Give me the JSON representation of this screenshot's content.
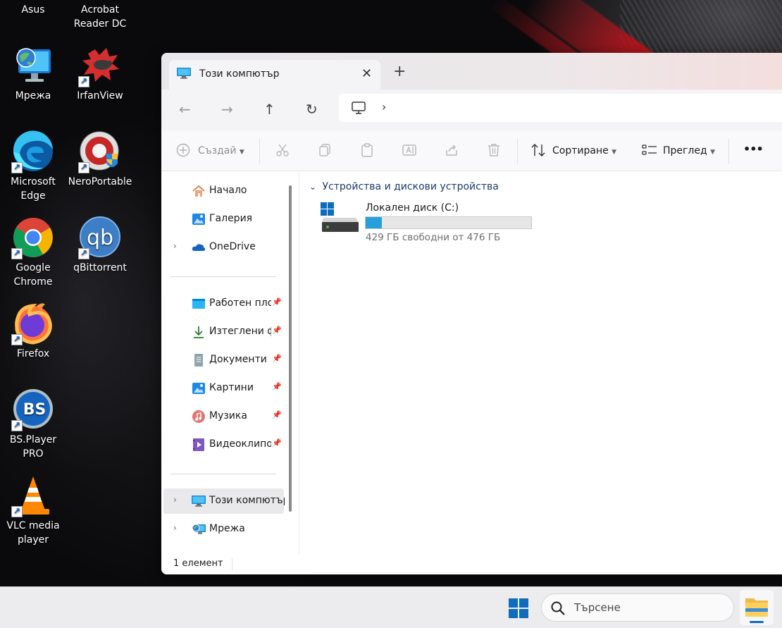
{
  "desktop": {
    "icons": [
      {
        "label": "Asus"
      },
      {
        "label": "Acrobat Reader DC"
      },
      {
        "label": "Мрежа"
      },
      {
        "label": "IrfanView"
      },
      {
        "label": "Microsoft Edge"
      },
      {
        "label": "NeroPortable"
      },
      {
        "label": "Google Chrome"
      },
      {
        "label": "qBittorrent"
      },
      {
        "label": "Firefox"
      },
      {
        "label": "BS.Player PRO"
      },
      {
        "label": "VLC media player"
      }
    ],
    "qb_glyph": "qb",
    "bs_glyph": "BS"
  },
  "window": {
    "tab_title": "Този компютър",
    "tab_close": "✕",
    "new_tab": "+",
    "nav": {
      "back": "←",
      "forward": "→",
      "up": "↑",
      "refresh": "↻",
      "chevron": "›"
    },
    "toolbar": {
      "create_label": "Създай",
      "sort_label": "Сортиране",
      "view_label": "Преглед",
      "more": "•••"
    },
    "sidebar": {
      "items": [
        {
          "label": "Начало"
        },
        {
          "label": "Галерия"
        },
        {
          "label": "OneDrive"
        },
        {
          "label": "Работен плот"
        },
        {
          "label": "Изтеглени файлове"
        },
        {
          "label": "Документи"
        },
        {
          "label": "Картини"
        },
        {
          "label": "Музика"
        },
        {
          "label": "Видеоклипове"
        },
        {
          "label": "Този компютър"
        },
        {
          "label": "Мрежа"
        }
      ],
      "chevron": "›",
      "pin": "📌"
    },
    "content": {
      "section_title": "Устройства и дискови устройства",
      "section_chevron": "⌄",
      "drive": {
        "name": "Локален диск (C:)",
        "free_text": "429 ГБ свободни от 476 ГБ",
        "used_fraction": 0.099
      }
    },
    "status": {
      "item_count": "1 елемент"
    }
  },
  "taskbar": {
    "search_placeholder": "Търсене"
  },
  "colors": {
    "accent": "#26a0da",
    "win_blue": "#0f6cbd",
    "section_text": "#1c3a70"
  }
}
